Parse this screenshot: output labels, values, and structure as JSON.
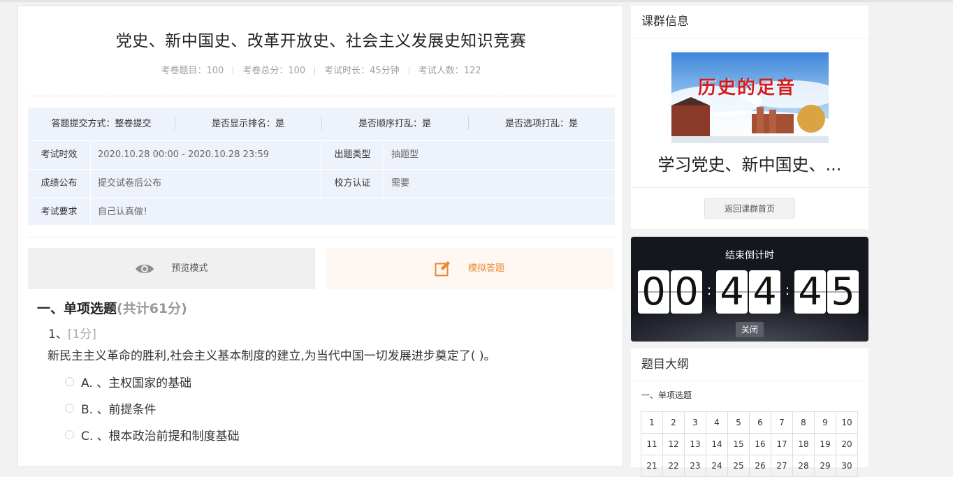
{
  "exam": {
    "title": "党史、新中国史、改革开放史、社会主义发展史知识竞赛",
    "stats": [
      "考卷题目：100",
      "考卷总分：100",
      "考试时长：45分钟",
      "考试人数：122"
    ]
  },
  "settings": {
    "submit_mode": "答题提交方式：整卷提交",
    "show_rank": "是否显示排名：是",
    "shuffle_order": "是否顺序打乱：是",
    "shuffle_options": "是否选项打乱：是"
  },
  "details": {
    "time_label": "考试时效",
    "time_value": "2020.10.28 00:00 - 2020.10.28 23:59",
    "type_label": "出题类型",
    "type_value": "抽题型",
    "score_label": "成绩公布",
    "score_value": "提交试卷后公布",
    "cert_label": "校方认证",
    "cert_value": "需要",
    "req_label": "考试要求",
    "req_value": "自己认真做！"
  },
  "modes": {
    "preview_label": "预览模式",
    "preview_icon": "eye-icon",
    "simulate_label": "模拟答题",
    "simulate_icon": "edit-icon",
    "simulate_color": "#e8882f"
  },
  "section": {
    "title": "一、单项选题",
    "points": "(共计61分)"
  },
  "question": {
    "number": "1、",
    "points": "[1分]",
    "text": "新民主主义革命的胜利,社会主义基本制度的建立,为当代中国一切发展进步奠定了( )。",
    "options": [
      {
        "label": "A. 、主权国家的基础"
      },
      {
        "label": "B. 、前提条件"
      },
      {
        "label": "C. 、根本政治前提和制度基础"
      }
    ]
  },
  "course": {
    "header": "课群信息",
    "banner_text": "历史的足音",
    "name": "学习党史、新中国史、...",
    "back_button": "返回课群首页"
  },
  "timer": {
    "label": "结束倒计时",
    "digits": [
      "0",
      "0",
      "4",
      "4",
      "4",
      "5"
    ],
    "close_button": "关闭"
  },
  "outline": {
    "header": "题目大纲",
    "section": "一、单项选题",
    "rows": [
      [
        "1",
        "2",
        "3",
        "4",
        "5",
        "6",
        "7",
        "8",
        "9",
        "10"
      ],
      [
        "11",
        "12",
        "13",
        "14",
        "15",
        "16",
        "17",
        "18",
        "19",
        "20"
      ],
      [
        "21",
        "22",
        "23",
        "24",
        "25",
        "26",
        "27",
        "28",
        "29",
        "30"
      ]
    ]
  }
}
